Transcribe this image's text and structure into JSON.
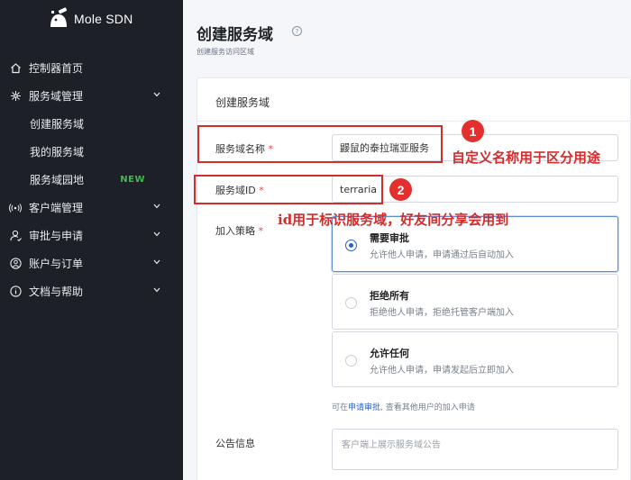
{
  "app": {
    "logo_text": "Mole SDN"
  },
  "sidebar": {
    "items": [
      {
        "label": "控制器首页",
        "icon": "home-icon"
      },
      {
        "label": "服务域管理",
        "icon": "network-icon",
        "expanded": true
      },
      {
        "label": "客户端管理",
        "icon": "client-icon"
      },
      {
        "label": "审批与申请",
        "icon": "user-approve-icon"
      },
      {
        "label": "账户与订单",
        "icon": "account-icon"
      },
      {
        "label": "文档与帮助",
        "icon": "info-icon"
      }
    ],
    "subitems": [
      {
        "label": "创建服务域"
      },
      {
        "label": "我的服务域"
      },
      {
        "label": "服务域园地",
        "badge": "NEW"
      }
    ]
  },
  "page": {
    "title": "创建服务域",
    "subtitle": "创建服务访问区域"
  },
  "form": {
    "card_title": "创建服务域",
    "name_label": "服务域名称",
    "name_value": "鼹鼠的泰拉瑞亚服务",
    "id_label": "服务域ID",
    "id_value": "terraria",
    "policy_label": "加入策略",
    "required_mark": "*",
    "policy_options": [
      {
        "title": "需要审批",
        "desc": "允许他人申请，申请通过后自动加入",
        "selected": true
      },
      {
        "title": "拒绝所有",
        "desc": "拒绝他人申请，拒绝托管客户端加入",
        "selected": false
      },
      {
        "title": "允许任何",
        "desc": "允许他人申请，申请发起后立即加入",
        "selected": false
      }
    ],
    "hint_prefix": "可在",
    "hint_link": "申请审批",
    "hint_suffix": "查看其他用户的加入申请",
    "notice_label": "公告信息",
    "notice_placeholder": "客户端上展示服务域公告"
  },
  "annotations": {
    "marker1": "1",
    "marker2": "2",
    "note1": "自定义名称用于区分用途",
    "note2": "id用于标识服务域，好友间分享会用到",
    "color": "#d42b2b"
  }
}
